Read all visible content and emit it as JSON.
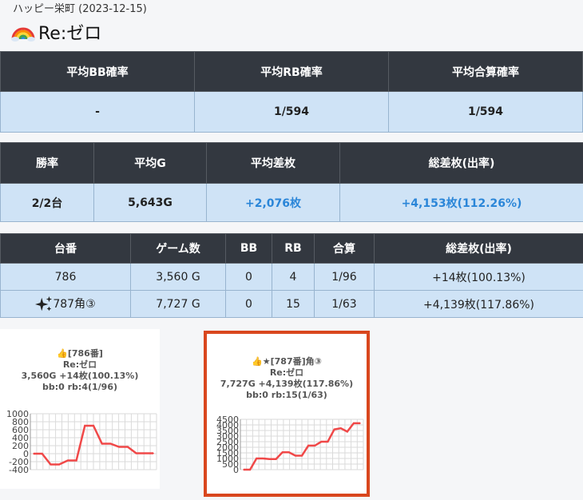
{
  "header": {
    "subtitle": "ハッピー栄町 (2023-12-15)",
    "title": "Re:ゼロ",
    "title_icon": "rainbow-icon"
  },
  "summary_probs": {
    "headers": [
      "平均BB確率",
      "平均RB確率",
      "平均合算確率"
    ],
    "values": [
      "-",
      "1/594",
      "1/594"
    ]
  },
  "summary_stats": {
    "headers": [
      "勝率",
      "平均G",
      "平均差枚",
      "総差枚(出率)"
    ],
    "values": [
      "2/2台",
      "5,643G",
      "+2,076枚",
      "+4,153枚(112.26%)"
    ]
  },
  "machines": {
    "headers": [
      "台番",
      "ゲーム数",
      "BB",
      "RB",
      "合算",
      "総差枚(出率)"
    ],
    "rows": [
      {
        "number": "786",
        "games": "3,560 G",
        "bb": "0",
        "rb": "4",
        "total": "1/96",
        "diff": "+14枚(100.13%)"
      },
      {
        "number": "787角③",
        "games": "7,727 G",
        "bb": "0",
        "rb": "15",
        "total": "1/63",
        "diff": "+4,139枚(117.86%)",
        "icon": "sparkles-icon"
      }
    ]
  },
  "cards": [
    {
      "line1": "👍[786番]",
      "line2": "Re:ゼロ",
      "line3": "3,560G +14枚(100.13%)",
      "line4": "bb:0 rb:4(1/96)",
      "highlighted": false,
      "chart_data": {
        "type": "line",
        "y_ticks": [
          "1000",
          "800",
          "600",
          "400",
          "200",
          "0",
          "-200",
          "-400"
        ],
        "ylim": [
          -400,
          1000
        ],
        "values": [
          0,
          0,
          -270,
          -270,
          -170,
          -170,
          700,
          700,
          250,
          250,
          170,
          170,
          10,
          10,
          10
        ],
        "color": "#f04848"
      }
    },
    {
      "line1": "👍★[787番]角③",
      "line2": "Re:ゼロ",
      "line3": "7,727G +4,139枚(117.86%)",
      "line4": "bb:0 rb:15(1/63)",
      "highlighted": true,
      "chart_data": {
        "type": "line",
        "y_ticks": [
          "4500",
          "4000",
          "3500",
          "3000",
          "2500",
          "2000",
          "1500",
          "1000",
          "500",
          "0"
        ],
        "ylim": [
          0,
          4500
        ],
        "values": [
          0,
          0,
          1000,
          1000,
          950,
          950,
          1550,
          1550,
          1250,
          1250,
          2150,
          2150,
          2500,
          2500,
          3600,
          3700,
          3400,
          4150,
          4150
        ],
        "color": "#f04848"
      }
    }
  ]
}
